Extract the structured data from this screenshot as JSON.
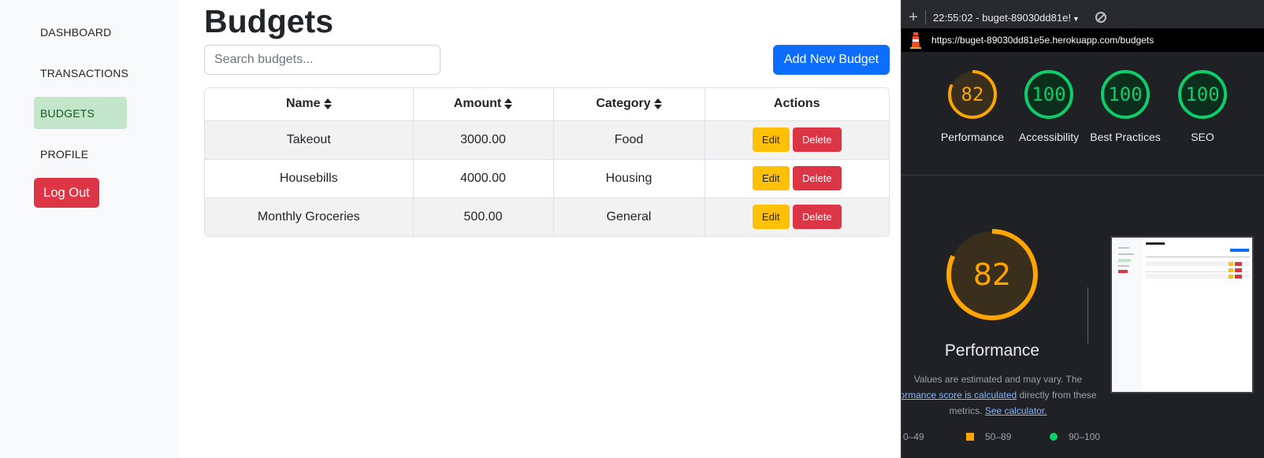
{
  "sidebar": {
    "items": [
      {
        "label": "DASHBOARD"
      },
      {
        "label": "TRANSACTIONS"
      },
      {
        "label": "BUDGETS"
      },
      {
        "label": "PROFILE"
      }
    ],
    "logout_label": "Log Out"
  },
  "main": {
    "title": "Budgets",
    "search_placeholder": "Search budgets...",
    "add_button_label": "Add New Budget",
    "table": {
      "headers": [
        "Name",
        "Amount",
        "Category",
        "Actions"
      ],
      "rows": [
        {
          "name": "Takeout",
          "amount": "3000.00",
          "category": "Food"
        },
        {
          "name": "Housebills",
          "amount": "4000.00",
          "category": "Housing"
        },
        {
          "name": "Monthly Groceries",
          "amount": "500.00",
          "category": "General"
        }
      ],
      "edit_label": "Edit",
      "delete_label": "Delete"
    }
  },
  "devtools": {
    "report_label": "22:55:02 - buget-89030dd81e!",
    "url": "https://buget-89030dd81e5e.herokuapp.com/budgets",
    "scores": [
      {
        "label": "Performance",
        "value": "82",
        "color": "#ffa400"
      },
      {
        "label": "Accessibility",
        "value": "100",
        "color": "#0cce6b"
      },
      {
        "label": "Best Practices",
        "value": "100",
        "color": "#0cce6b"
      },
      {
        "label": "SEO",
        "value": "100",
        "color": "#0cce6b"
      }
    ],
    "main_score": {
      "value": "82",
      "title": "Performance"
    },
    "description": {
      "text1": "Values are estimated and may vary. The",
      "link1": "ormance score is calculated",
      "text2": " directly from these metrics. ",
      "link2": "See calculator."
    },
    "legend": [
      {
        "label": "0–49"
      },
      {
        "label": "50–89"
      },
      {
        "label": "90–100"
      }
    ]
  }
}
